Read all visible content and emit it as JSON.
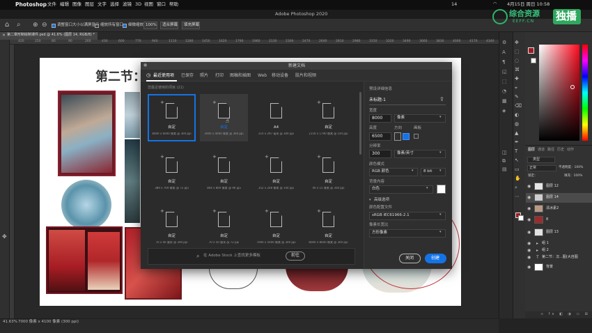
{
  "macbar": {
    "apple": "",
    "app_name": "Photoshop",
    "menus": [
      "文件",
      "编辑",
      "图像",
      "图层",
      "文字",
      "选择",
      "滤镜",
      "3D",
      "视图",
      "窗口",
      "帮助"
    ],
    "status_num": "14",
    "datetime": "4月15日 周日 10:58"
  },
  "window": {
    "title": "Adobe Photoshop 2020"
  },
  "options": {
    "cb1": "调整窗口大小以满屏显示",
    "cb2": "缩放所有窗口",
    "cb3": "细微缩放",
    "zoom": "100%",
    "fit_screen": "适合屏幕",
    "fill_screen": "填充屏幕"
  },
  "doc": {
    "tab": "第二章形制绘制课件.psd @ 41.6% (图层 14, RGB/8) *",
    "ruler_labels": [
      "420",
      "250",
      "80",
      "90",
      "260",
      "430",
      "600",
      "770",
      "940",
      "1110",
      "1280",
      "1450",
      "1620",
      "1790",
      "1960",
      "2130",
      "2300",
      "2470",
      "2640",
      "2810",
      "2980",
      "3150",
      "3320",
      "3490",
      "3660",
      "3830",
      "4000",
      "4170",
      "4340"
    ],
    "heading": "第二节："
  },
  "statusbar": {
    "zoom": "41.63%",
    "info": "7000 像素 x 4100 像素 (300 ppi)"
  },
  "dialog": {
    "title": "新建文档",
    "tabs": [
      "最近使用项",
      "已保存",
      "照片",
      "打印",
      "图稿和插图",
      "Web",
      "移动设备",
      "胶片和视频"
    ],
    "section_label": "您最近使用的项目 (21)",
    "presets": [
      {
        "name": "自定",
        "info": "8000 x 6000 像素 @ 300 ppi"
      },
      {
        "name": "自定",
        "info": "3000 x 4000 像素 @ 300 ppi"
      },
      {
        "name": "A4",
        "info": "210 x 297 毫米 @ 300 ppi"
      },
      {
        "name": "自定",
        "info": "2150 x 1790 像素 @ 144 ppi"
      },
      {
        "name": "自定",
        "info": "389 x 769 像素 @ 72 ppi"
      },
      {
        "name": "自定",
        "info": "804 x 869 像素 @ 96 ppi"
      },
      {
        "name": "自定",
        "info": "352 x 248 像素 @ 144 ppi"
      },
      {
        "name": "自定",
        "info": "40 x 15 像素 @ 300 ppi"
      },
      {
        "name": "自定",
        "info": "70 x 40 厘米 @ 300 ppi"
      },
      {
        "name": "自定",
        "info": "70 x 50 厘米 @ 72 ppi"
      },
      {
        "name": "自定",
        "info": "7000 x 5000 像素 @ 300 ppi"
      },
      {
        "name": "自定",
        "info": "8000 x 8000 像素 @ 300 ppi"
      }
    ],
    "stock_placeholder": "在 Adobe Stock 上查找更多模板",
    "go_label": "前往",
    "details": {
      "section": "预设详细信息",
      "name": "未标题-1",
      "width_label": "宽度",
      "width_value": "8000",
      "width_unit": "像素",
      "height_label": "高度",
      "orient_label": "方向",
      "artboard_label": "画板",
      "height_value": "6500",
      "res_label": "分辨率",
      "res_value": "300",
      "res_unit": "像素/英寸",
      "color_mode_label": "颜色模式",
      "color_mode": "RGB 颜色",
      "bit_depth": "8 bit",
      "bg_label": "背景内容",
      "bg_value": "白色",
      "advanced": "高级选项",
      "profile_label": "颜色配置文件",
      "profile_value": "sRGB IEC61966-2.1",
      "aspect_label": "像素长宽比",
      "aspect_value": "方形像素"
    },
    "close_label": "关闭",
    "create_label": "创建"
  },
  "right": {
    "layers_tabs": [
      "图层",
      "通道",
      "路径",
      "历史",
      "动作"
    ],
    "kind": "类型",
    "mode": "正常",
    "opacity": "不透明度：100%",
    "lock": "锁定：",
    "fill": "填充：100%",
    "layers": [
      {
        "name": "图层 12",
        "thumb": "#e6e6e6"
      },
      {
        "name": "图层 14",
        "thumb": "#cfcfcf"
      },
      {
        "name": "清冰素2",
        "thumb": "#b79a86"
      },
      {
        "name": "8",
        "thumb": "#9c2c2c"
      },
      {
        "name": "图层 13",
        "thumb": "#e2e2e2"
      },
      {
        "name": "组 1",
        "thumb": ""
      },
      {
        "name": "组 2",
        "thumb": ""
      },
      {
        "name": "第二节：汉...图(大自图",
        "thumb": ""
      },
      {
        "name": "背景",
        "thumb": "#ffffff"
      }
    ]
  },
  "watermark": {
    "logo_text": "综合资源",
    "sub": "EEFF.CN",
    "badge": "独播"
  },
  "colors": {
    "accent": "#1473e6",
    "panel": "#323232",
    "dialog": "#2b2b2b"
  }
}
